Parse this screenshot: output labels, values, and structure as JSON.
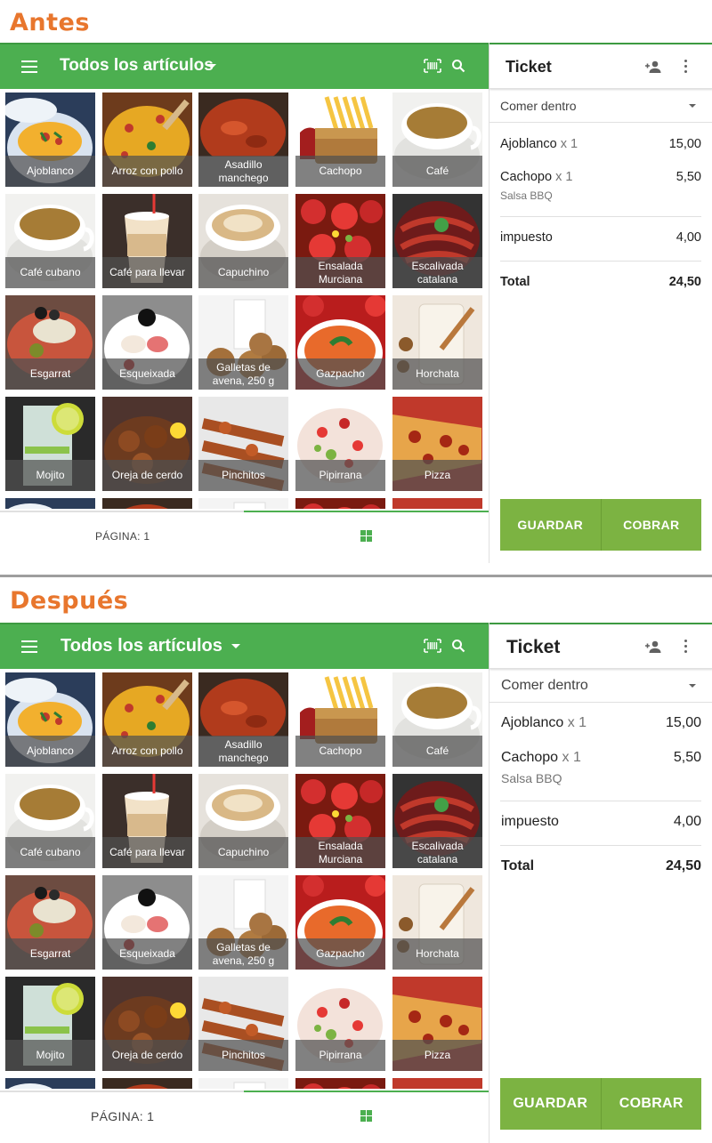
{
  "sections": [
    {
      "title": "Antes"
    },
    {
      "title": "Después"
    }
  ],
  "toolbar": {
    "category_title": "Todos los artículos",
    "menu_icon": "menu-icon",
    "barcode_icon": "barcode-scan-icon",
    "search_icon": "search-icon"
  },
  "products": [
    {
      "label": "Ajoblanco",
      "art": "soup"
    },
    {
      "label": "Arroz con pollo",
      "art": "rice"
    },
    {
      "label": "Asadillo manchego",
      "art": "stew"
    },
    {
      "label": "Cachopo",
      "art": "cachopo"
    },
    {
      "label": "Café",
      "art": "cafe"
    },
    {
      "label": "Café cubano",
      "art": "cafe"
    },
    {
      "label": "Café para llevar",
      "art": "cup"
    },
    {
      "label": "Capuchino",
      "art": "capuchino"
    },
    {
      "label": "Ensalada Murciana",
      "art": "tomato"
    },
    {
      "label": "Escalivada catalana",
      "art": "escalivada"
    },
    {
      "label": "Esgarrat",
      "art": "esgarrat"
    },
    {
      "label": "Esqueixada",
      "art": "esqueixada"
    },
    {
      "label": "Galletas de avena, 250 g",
      "art": "cookies"
    },
    {
      "label": "Gazpacho",
      "art": "gazpacho"
    },
    {
      "label": "Horchata",
      "art": "horchata"
    },
    {
      "label": "Mojito",
      "art": "mojito"
    },
    {
      "label": "Oreja de cerdo",
      "art": "oreja"
    },
    {
      "label": "Pinchitos",
      "art": "pinchitos"
    },
    {
      "label": "Pipirrana",
      "art": "pipirrana"
    },
    {
      "label": "Pizza",
      "art": "pizza"
    }
  ],
  "footer": {
    "page_label": "PÁGINA: 1",
    "grid_icon": "grid-view-icon"
  },
  "ticket": {
    "title": "Ticket",
    "add_customer_icon": "add-person-icon",
    "more_icon": "more-vert-icon",
    "dining_option": "Comer dentro",
    "items": [
      {
        "name": "Ajoblanco",
        "qty": "x 1",
        "amount": "15,00",
        "modifier": ""
      },
      {
        "name": "Cachopo",
        "qty": "x 1",
        "amount": "5,50",
        "modifier": "Salsa BBQ"
      }
    ],
    "tax_label": "impuesto",
    "tax_amount": "4,00",
    "total_label": "Total",
    "total_amount": "24,50",
    "save_label": "GUARDAR",
    "charge_label": "COBRAR"
  },
  "colors": {
    "accent_green": "#4caf50",
    "button_green": "#7cb342",
    "title_orange": "#e8762d"
  }
}
